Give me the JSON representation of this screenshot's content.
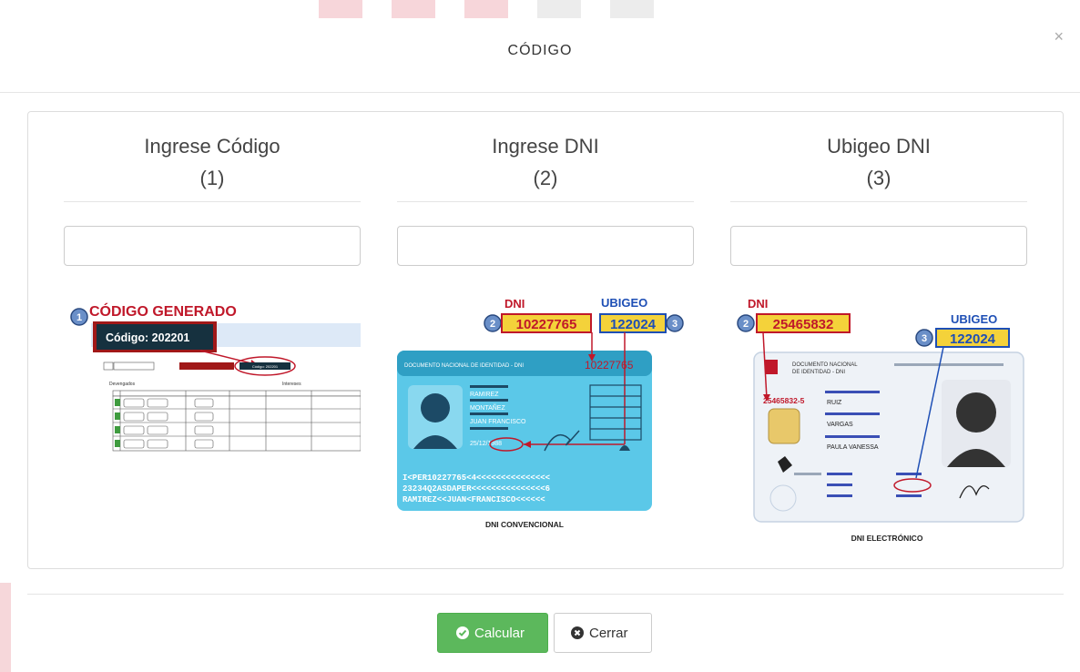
{
  "modal": {
    "title": "CÓDIGO",
    "close_label": "×"
  },
  "columns": [
    {
      "title": "Ingrese Código",
      "subtitle": "(1)",
      "input_value": ""
    },
    {
      "title": "Ingrese DNI",
      "subtitle": "(2)",
      "input_value": ""
    },
    {
      "title": "Ubigeo DNI",
      "subtitle": "(3)",
      "input_value": ""
    }
  ],
  "help_images": {
    "codigo": {
      "heading": "CÓDIGO GENERADO",
      "step": "1",
      "code_label": "Código: 202201",
      "small_button": "Código: 202201",
      "section_left": "Devengados",
      "section_right": "Intereses"
    },
    "dni_convencional": {
      "dni_label": "DNI",
      "ubigeo_label": "UBIGEO",
      "dni_step": "2",
      "dni_value": "10227765",
      "ubigeo_value": "122024",
      "ubigeo_step": "3",
      "card_header": "DOCUMENTO NACIONAL DE IDENTIDAD - DNI",
      "card_number": "10227765",
      "surname1": "RAMIREZ",
      "surname2": "MONTAÑEZ",
      "names": "JUAN FRANCISCO",
      "birth": "25/12/1988",
      "mrz1": "I<PER10227765<4<<<<<<<<<<<<<<<",
      "mrz2": "23234Q2ASDAPER<<<<<<<<<<<<<<<6",
      "mrz3": "RAMIREZ<<JUAN<FRANCISCO<<<<<<",
      "caption": "DNI CONVENCIONAL"
    },
    "dni_electronico": {
      "dni_label": "DNI",
      "ubigeo_label": "UBIGEO",
      "dni_step": "2",
      "dni_value": "25465832",
      "ubigeo_step": "3",
      "ubigeo_value": "122024",
      "card_header1": "DOCUMENTO NACIONAL",
      "card_header2": "DE IDENTIDAD - DNI",
      "card_number": "25465832-5",
      "surname1": "RUIZ",
      "surname2": "VARGAS",
      "names": "PAULA VANESSA",
      "caption": "DNI ELECTRÓNICO"
    }
  },
  "footer": {
    "calcular_label": "Calcular",
    "cerrar_label": "Cerrar"
  },
  "colors": {
    "primary_green": "#5cb85c",
    "dark_red": "#b22222",
    "card_blue": "#5bc8e8",
    "label_blue": "#1e4fb5"
  }
}
